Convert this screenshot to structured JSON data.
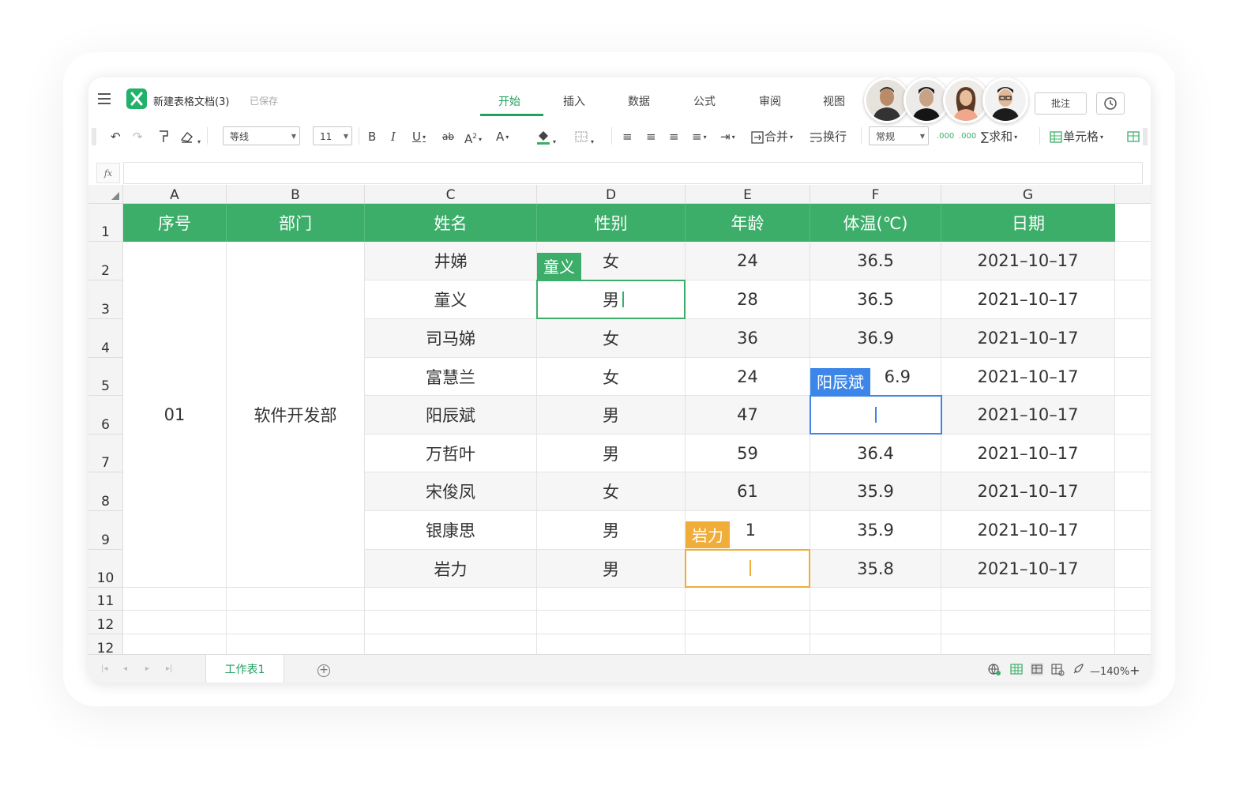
{
  "app": {
    "doc_title": "新建表格文档(3)",
    "save_status": "已保存",
    "accent": "#3dae6a"
  },
  "tabs": [
    {
      "label": "开始",
      "active": true
    },
    {
      "label": "插入"
    },
    {
      "label": "数据"
    },
    {
      "label": "公式"
    },
    {
      "label": "审阅"
    },
    {
      "label": "视图"
    }
  ],
  "header_buttons": {
    "comment": "批注",
    "history_icon": "clock-icon"
  },
  "toolbar": {
    "font_name": "等线",
    "font_size": "11",
    "bold": "B",
    "italic": "I",
    "underline": "U",
    "strike": "ab",
    "superscript": "A",
    "font_color": "A",
    "merge": "合并",
    "wrap": "换行",
    "number_format": "常规",
    "sum": "求和",
    "cell": "单元格"
  },
  "formula_bar": {
    "icon": "fx",
    "value": ""
  },
  "columns": [
    "A",
    "B",
    "C",
    "D",
    "E",
    "F",
    "G"
  ],
  "row_numbers": [
    "1",
    "2",
    "3",
    "4",
    "5",
    "6",
    "7",
    "8",
    "9",
    "10",
    "11",
    "12",
    "12"
  ],
  "table": {
    "headers": [
      "序号",
      "部门",
      "姓名",
      "性别",
      "年龄",
      "体温(℃)",
      "日期"
    ],
    "merged_id": "01",
    "merged_dept": "软件开发部",
    "rows": [
      {
        "name": "井娣",
        "gender": "女",
        "age": "24",
        "temp": "36.5",
        "date": "2021–10–17"
      },
      {
        "name": "童义",
        "gender": "男",
        "age": "28",
        "temp": "36.5",
        "date": "2021–10–17"
      },
      {
        "name": "司马娣",
        "gender": "女",
        "age": "36",
        "temp": "36.9",
        "date": "2021–10–17"
      },
      {
        "name": "富慧兰",
        "gender": "女",
        "age": "24",
        "temp": "6.9",
        "date": "2021–10–17"
      },
      {
        "name": "阳辰斌",
        "gender": "男",
        "age": "47",
        "temp": "",
        "date": "2021–10–17"
      },
      {
        "name": "万哲叶",
        "gender": "男",
        "age": "59",
        "temp": "36.4",
        "date": "2021–10–17"
      },
      {
        "name": "宋俊凤",
        "gender": "女",
        "age": "61",
        "temp": "35.9",
        "date": "2021–10–17"
      },
      {
        "name": "银康思",
        "gender": "男",
        "age": "1",
        "temp": "35.9",
        "date": "2021–10–17"
      },
      {
        "name": "岩力",
        "gender": "男",
        "age": "",
        "temp": "35.8",
        "date": "2021–10–17"
      }
    ]
  },
  "collaborators": [
    {
      "name": "童义",
      "color": "#3dae6a"
    },
    {
      "name": "阳辰斌",
      "color": "#3b86e8"
    },
    {
      "name": "岩力",
      "color": "#f0ad3a"
    }
  ],
  "bottom_bar": {
    "sheet_tab": "工作表1",
    "zoom_minus": "—",
    "zoom": "140%",
    "zoom_plus": "+"
  }
}
